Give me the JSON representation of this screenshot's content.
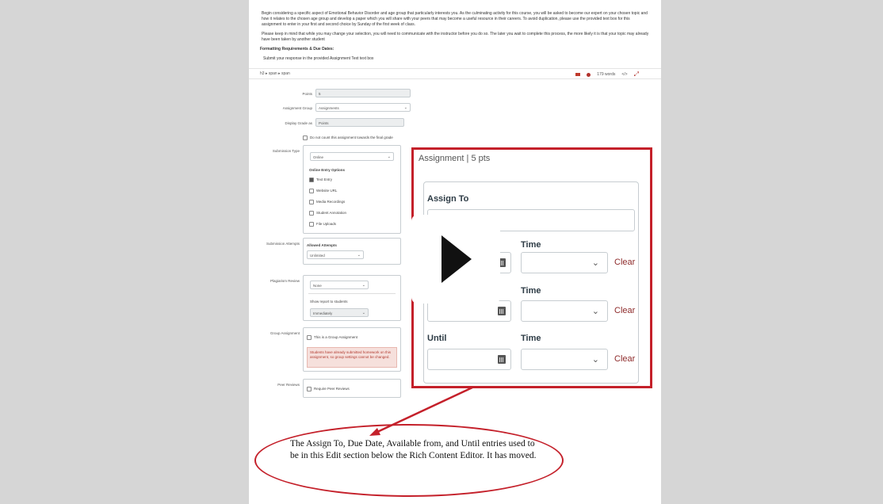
{
  "description": {
    "para1": "Begin considering a specific aspect of Emotional Behavior Disorder and age group that particularly interests you. As the culminating activity for this course, you will be asked to become our expert on your chosen topic and how it relates to the chosen age group and develop a paper which you will share with your peers that may become a useful resource in their careers. To avoid duplication, please use the provided text box for this assignment to enter in your first and second choice by Sunday of the first week of class.",
    "para2": "Please keep in mind that while you may change your selection, you will need to communicate with the instructor before you do so. The later you wait to complete this process, the more likely it is that your topic may already have been taken by another student",
    "heading": "Formatting Requirements & Due Dates:",
    "bullet": "Submit your response in the provided Assignment Text text box"
  },
  "editor_bar": {
    "path": "h3 ▸ span ▸ span",
    "words": "179 words",
    "html": "</>"
  },
  "form": {
    "points_label": "Points",
    "points_value": "5",
    "group_label": "Assignment Group",
    "group_value": "Assignments",
    "display_label": "Display Grade as",
    "display_value": "Points",
    "no_count_label": "Do not count this assignment towards the final grade",
    "submission_label": "Submission Type",
    "submission_value": "Online",
    "online_options_title": "Online Entry Options",
    "options": [
      "Text Entry",
      "Website URL",
      "Media Recordings",
      "Student Annotation",
      "File Uploads"
    ],
    "attempts_label": "Submission Attempts",
    "attempts_title": "Allowed Attempts",
    "attempts_value": "Unlimited",
    "plagiarism_label": "Plagiarism Review",
    "plagiarism_value": "None",
    "show_report_label": "Show report to students",
    "show_report_value": "Immediately",
    "group_assignment_label": "Group Assignment",
    "group_assignment_checkbox": "This is a Group Assignment",
    "group_warning": "Students have already submitted homework on this assignment, so group settings cannot be changed.",
    "peer_label": "Peer Reviews",
    "peer_checkbox": "Require Peer Reviews"
  },
  "panel": {
    "title": "Assignment | 5 pts",
    "assign_to": "Assign To",
    "time1": "Time",
    "time2": "Time",
    "until": "Until",
    "time3": "Time",
    "clear": "Clear"
  },
  "annotation": {
    "note": "The Assign To, Due Date, Available from, and Until entries used to be in this Edit section below the Rich Content Editor. It has moved."
  }
}
